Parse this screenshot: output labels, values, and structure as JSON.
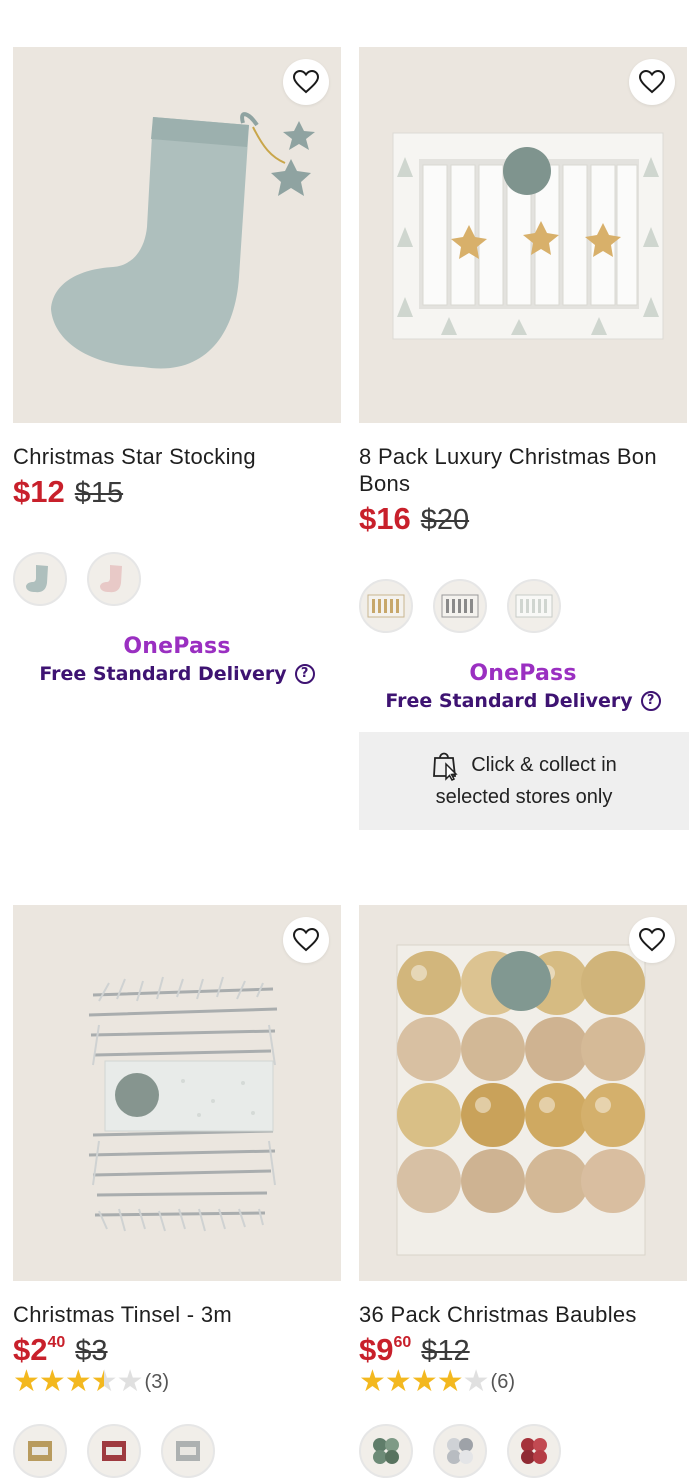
{
  "products": [
    {
      "title": "Christmas Star Stocking",
      "price_main": "$12",
      "price_cents": "",
      "was_price": "$15",
      "colors": {
        "bg": "#ebe6df"
      },
      "swatches": [
        "stocking-blue",
        "stocking-pink"
      ],
      "onepass_label": "OnePass",
      "delivery_label": "Free Standard Delivery",
      "help_glyph": "?"
    },
    {
      "title": "8 Pack Luxury Christmas Bon Bons",
      "price_main": "$16",
      "price_cents": "",
      "was_price": "$20",
      "swatches": [
        "bonbon-gold",
        "bonbon-silver",
        "bonbon-white"
      ],
      "onepass_label": "OnePass",
      "delivery_label": "Free Standard Delivery",
      "help_glyph": "?",
      "collect_line1": "Click & collect in",
      "collect_line2": "selected stores only"
    },
    {
      "title": "Christmas Tinsel - 3m",
      "price_main": "$2",
      "price_cents": "40",
      "was_price": "$3",
      "rating": 3.5,
      "rating_count": "(3)",
      "swatches": [
        "tinsel-gold",
        "tinsel-red",
        "tinsel-silver"
      ]
    },
    {
      "title": "36 Pack Christmas Baubles",
      "price_main": "$9",
      "price_cents": "60",
      "was_price": "$12",
      "rating": 4,
      "rating_count": "(6)",
      "swatches": [
        "bauble-green",
        "bauble-mixed",
        "bauble-red"
      ]
    }
  ],
  "icons": {
    "wishlist": "heart-icon",
    "collect": "shopping-bag-cursor-icon"
  },
  "brand_colors": {
    "sale_red": "#c8202b",
    "onepass_purple": "#9a2fc1",
    "delivery_purple": "#3e1372",
    "star_yellow": "#f3b81f"
  }
}
